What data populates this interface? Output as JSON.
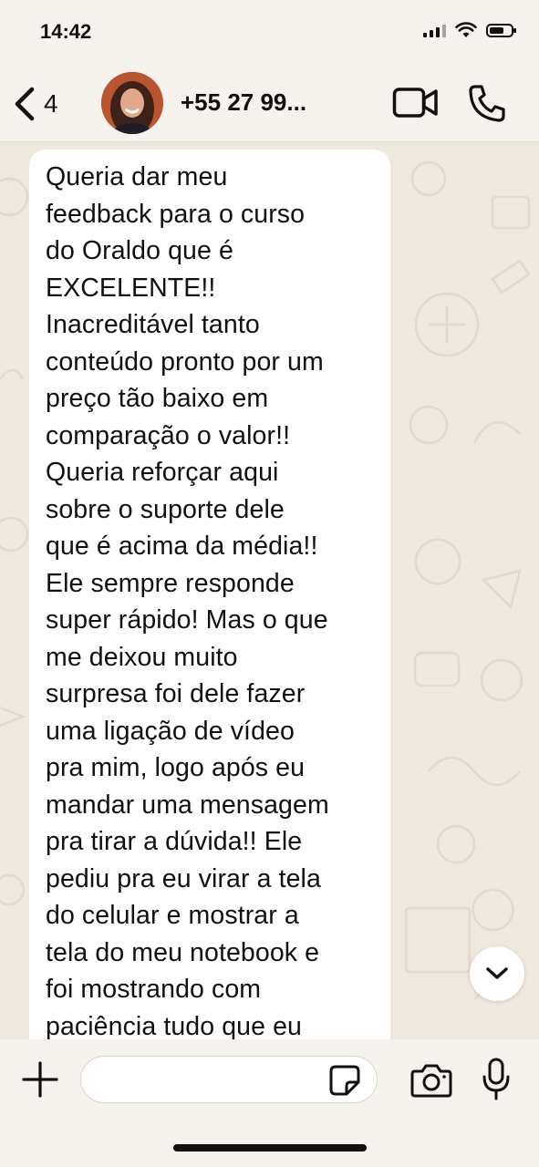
{
  "status_bar": {
    "time": "14:42",
    "icons": [
      "cellular-signal-icon",
      "wifi-icon",
      "battery-icon"
    ]
  },
  "header": {
    "back_icon": "chevron-left-icon",
    "back_count": "4",
    "contact_name": "+55 27 99...",
    "video_icon": "video-camera-icon",
    "call_icon": "phone-icon"
  },
  "chat": {
    "messages": [
      {
        "direction": "incoming",
        "text": "Queria dar meu\nfeedback para o curso\ndo Oraldo que é\nEXCELENTE!!\nInacreditável tanto\nconteúdo pronto por um\npreço tão baixo em\ncomparação o valor!!\nQueria reforçar aqui\nsobre o suporte dele\nque é acima da média!!\nEle sempre responde\nsuper rápido! Mas o que\nme deixou muito\nsurpresa foi dele fazer\numa ligação de vídeo\npra mim, logo após eu\nmandar uma mensagem\npra tirar a dúvida!! Ele\npediu pra eu virar a tela\ndo celular e mostrar a\ntela do meu notebook e\nfoi mostrando com\npaciência tudo que eu"
      }
    ],
    "scroll_icon": "chevron-down-icon"
  },
  "composer": {
    "plus_icon": "plus-icon",
    "input_value": "",
    "sticker_icon": "sticker-icon",
    "camera_icon": "camera-icon",
    "mic_icon": "microphone-icon"
  },
  "colors": {
    "wallpaper": "#efe8de",
    "bubble": "#ffffff",
    "bars": "#f6f3ef",
    "text": "#111111"
  }
}
